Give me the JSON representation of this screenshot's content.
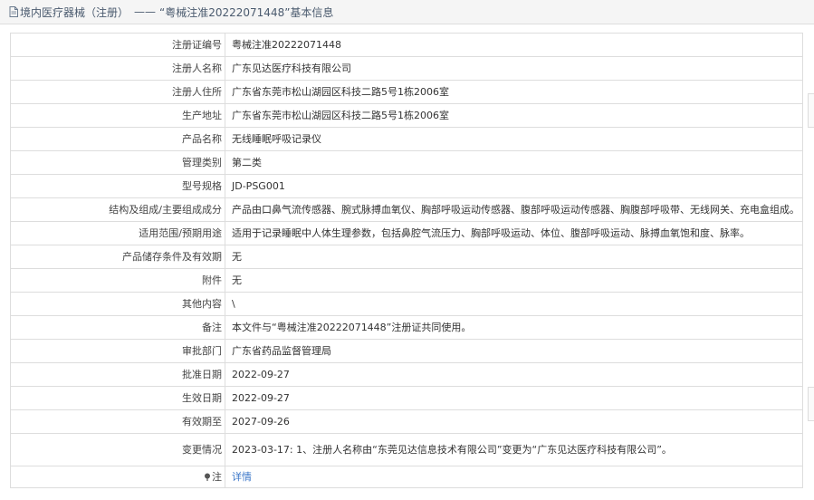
{
  "header": {
    "prefix": "境内医疗器械（注册）",
    "separator": "——",
    "title": "“粤械注准20222071448”基本信息"
  },
  "rows": [
    {
      "label": "注册证编号",
      "value": "粤械注准20222071448"
    },
    {
      "label": "注册人名称",
      "value": "广东见达医疗科技有限公司"
    },
    {
      "label": "注册人住所",
      "value": "广东省东莞市松山湖园区科技二路5号1栋2006室"
    },
    {
      "label": "生产地址",
      "value": "广东省东莞市松山湖园区科技二路5号1栋2006室"
    },
    {
      "label": "产品名称",
      "value": "无线睡眠呼吸记录仪"
    },
    {
      "label": "管理类别",
      "value": "第二类"
    },
    {
      "label": "型号规格",
      "value": "JD-PSG001"
    },
    {
      "label": "结构及组成/主要组成成分",
      "value": "产品由口鼻气流传感器、腕式脉搏血氧仪、胸部呼吸运动传感器、腹部呼吸运动传感器、胸腹部呼吸带、无线网关、充电盒组成。"
    },
    {
      "label": "适用范围/预期用途",
      "value": "适用于记录睡眠中人体生理参数，包括鼻腔气流压力、胸部呼吸运动、体位、腹部呼吸运动、脉搏血氧饱和度、脉率。"
    },
    {
      "label": "产品储存条件及有效期",
      "value": "无"
    },
    {
      "label": "附件",
      "value": "无"
    },
    {
      "label": "其他内容",
      "value": "\\"
    },
    {
      "label": "备注",
      "value": "本文件与“粤械注准20222071448”注册证共同使用。"
    },
    {
      "label": "审批部门",
      "value": "广东省药品监督管理局"
    },
    {
      "label": "批准日期",
      "value": "2022-09-27"
    },
    {
      "label": "生效日期",
      "value": "2022-09-27"
    },
    {
      "label": "有效期至",
      "value": "2027-09-26"
    }
  ],
  "change_row": {
    "label": "变更情况",
    "value": "2023-03-17: 1、注册人名称由“东莞见达信息技术有限公司”变更为“广东见达医疗科技有限公司”。"
  },
  "note_row": {
    "label": "注",
    "link": "详情",
    "icon": "pin-icon"
  }
}
